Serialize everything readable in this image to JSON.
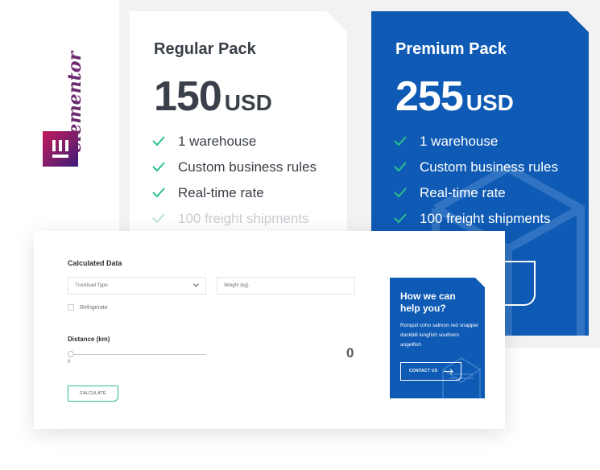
{
  "brand": {
    "wordmark": "elementor",
    "badge_icon": "elementor-e-icon"
  },
  "pricing": {
    "regular": {
      "title": "Regular Pack",
      "amount": "150",
      "currency": "USD",
      "features": [
        "1 warehouse",
        "Custom business rules",
        "Real-time rate",
        "100 freight shipments"
      ]
    },
    "premium": {
      "title": "Premium Pack",
      "amount": "255",
      "currency": "USD",
      "features": [
        "1 warehouse",
        "Custom business rules",
        "Real-time rate",
        "100 freight shipments"
      ]
    }
  },
  "calculator": {
    "title": "Calculated Data",
    "truck_select": "Truckload Type",
    "weight_placeholder": "Weight (kg)",
    "refrigerate_label": "Refrigerate",
    "distance_label": "Distance (km)",
    "slider_min": "0",
    "distance_value": "0",
    "calculate_label": "CALCULATE"
  },
  "help": {
    "title": "How we can help you?",
    "text": "Ronquil coho salmon red snapper duckbill lungfish southern angelfish",
    "contact_label": "CONTACT US"
  },
  "colors": {
    "accent_blue": "#0e5ab4",
    "check_green": "#2cbf8e",
    "logo_purple": "#6b2b6e"
  }
}
